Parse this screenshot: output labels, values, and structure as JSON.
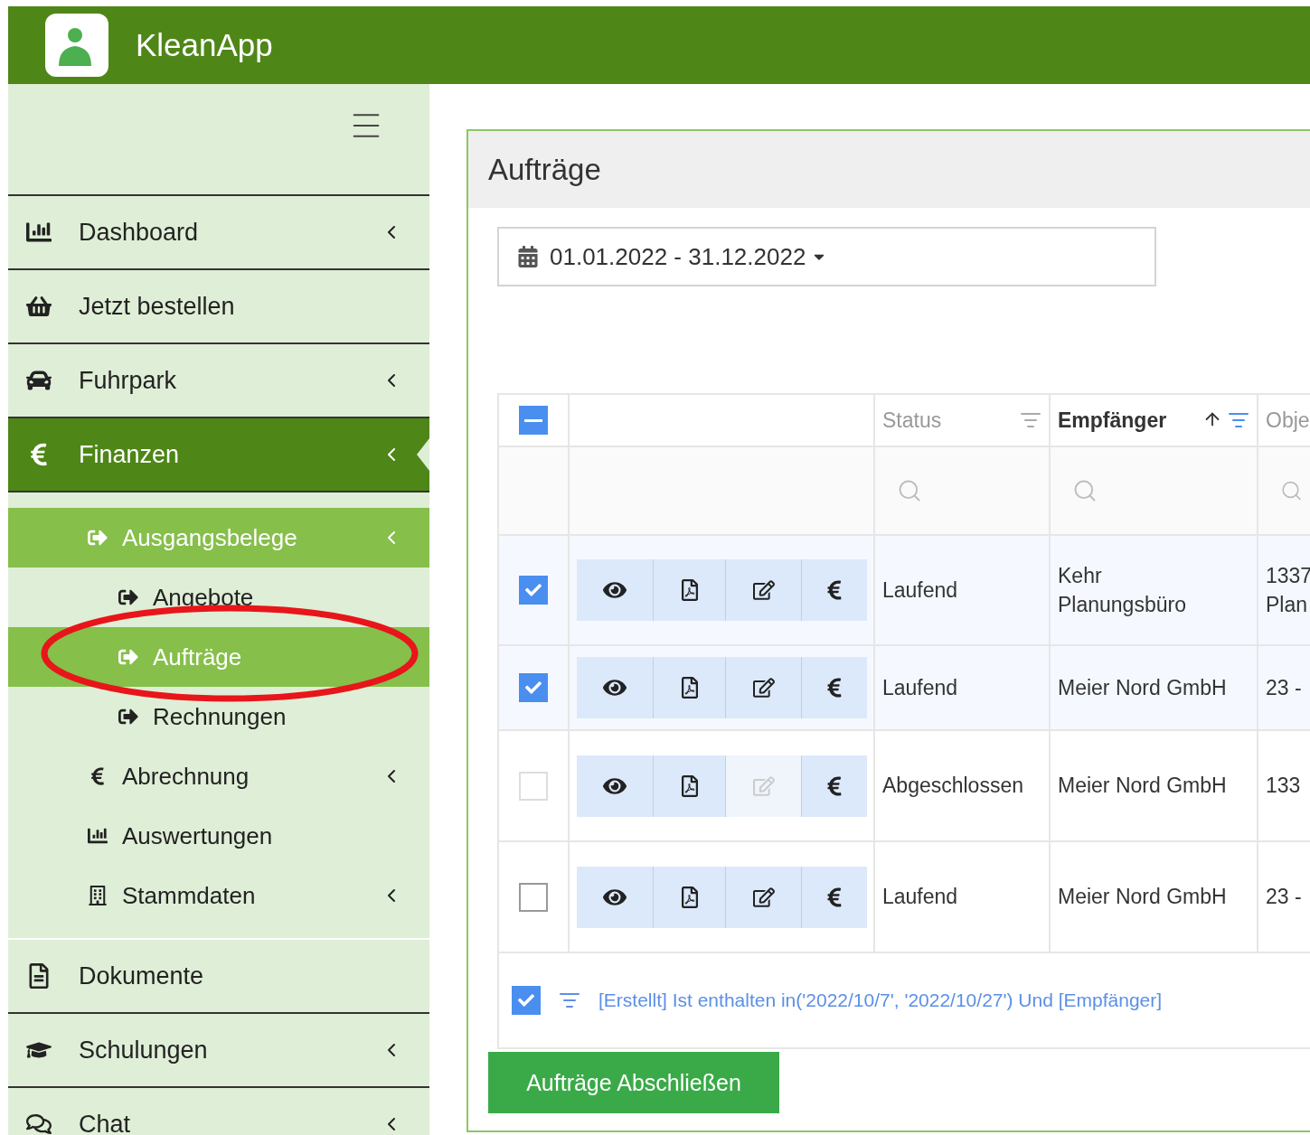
{
  "app": {
    "title": "KleanApp"
  },
  "sidebar": {
    "items": [
      {
        "label": "Dashboard",
        "has_submenu": true,
        "selected": false
      },
      {
        "label": "Jetzt bestellen",
        "has_submenu": false,
        "selected": false
      },
      {
        "label": "Fuhrpark",
        "has_submenu": true,
        "selected": false
      },
      {
        "label": "Finanzen",
        "has_submenu": true,
        "selected": true,
        "children": [
          {
            "label": "Ausgangsbelege",
            "has_submenu": true,
            "selected": true,
            "children": [
              {
                "label": "Angebote",
                "has_submenu": false,
                "selected": false
              },
              {
                "label": "Aufträge",
                "has_submenu": false,
                "selected": true
              },
              {
                "label": "Rechnungen",
                "has_submenu": false,
                "selected": false
              }
            ]
          },
          {
            "label": "Abrechnung",
            "has_submenu": true,
            "selected": false
          },
          {
            "label": "Auswertungen",
            "has_submenu": false,
            "selected": false
          },
          {
            "label": "Stammdaten",
            "has_submenu": true,
            "selected": false
          }
        ]
      },
      {
        "label": "Dokumente",
        "has_submenu": false,
        "selected": false
      },
      {
        "label": "Schulungen",
        "has_submenu": true,
        "selected": false
      },
      {
        "label": "Chat",
        "has_submenu": true,
        "selected": false
      }
    ]
  },
  "panel": {
    "title": "Aufträge",
    "date_range": {
      "value": "01.01.2022 - 31.12.2022"
    },
    "table": {
      "select_all": {
        "indeterminate": true
      },
      "columns": [
        {
          "label": "Status",
          "sorted_ascending": false,
          "show_filter": true,
          "filter_active": false
        },
        {
          "label": "Empfänger",
          "sorted_ascending": true,
          "show_filter": true,
          "filter_active": true
        },
        {
          "label": "Obje",
          "sorted_ascending": false,
          "show_filter": false
        }
      ],
      "rows": [
        {
          "checked": true,
          "disabled": false,
          "actions": [
            {
              "disabled": false
            },
            {
              "disabled": false
            },
            {
              "disabled": false
            },
            {
              "disabled": false
            }
          ],
          "status": "Laufend",
          "recipient": "Kehr Planungsbüro",
          "column_3": "1337\nPlan"
        },
        {
          "checked": true,
          "disabled": false,
          "actions": [
            {
              "disabled": false
            },
            {
              "disabled": false
            },
            {
              "disabled": false
            },
            {
              "disabled": false
            }
          ],
          "status": "Laufend",
          "recipient": "Meier Nord GmbH",
          "column_3": "23 -"
        },
        {
          "checked": false,
          "disabled": true,
          "actions": [
            {
              "disabled": false
            },
            {
              "disabled": false
            },
            {
              "disabled": true
            },
            {
              "disabled": false
            }
          ],
          "status": "Abgeschlossen",
          "recipient": "Meier Nord GmbH",
          "column_3": "133"
        },
        {
          "checked": false,
          "disabled": false,
          "actions": [
            {
              "disabled": false
            },
            {
              "disabled": false
            },
            {
              "disabled": false
            },
            {
              "disabled": false
            }
          ],
          "status": "Laufend",
          "recipient": "Meier Nord GmbH",
          "column_3": "23 -"
        }
      ],
      "filter": {
        "enabled": true,
        "text": "[Erstellt] Ist enthalten in('2022/10/7', '2022/10/27') Und [Empfänger]"
      }
    },
    "button": {
      "label": "Aufträge Abschließen"
    }
  }
}
